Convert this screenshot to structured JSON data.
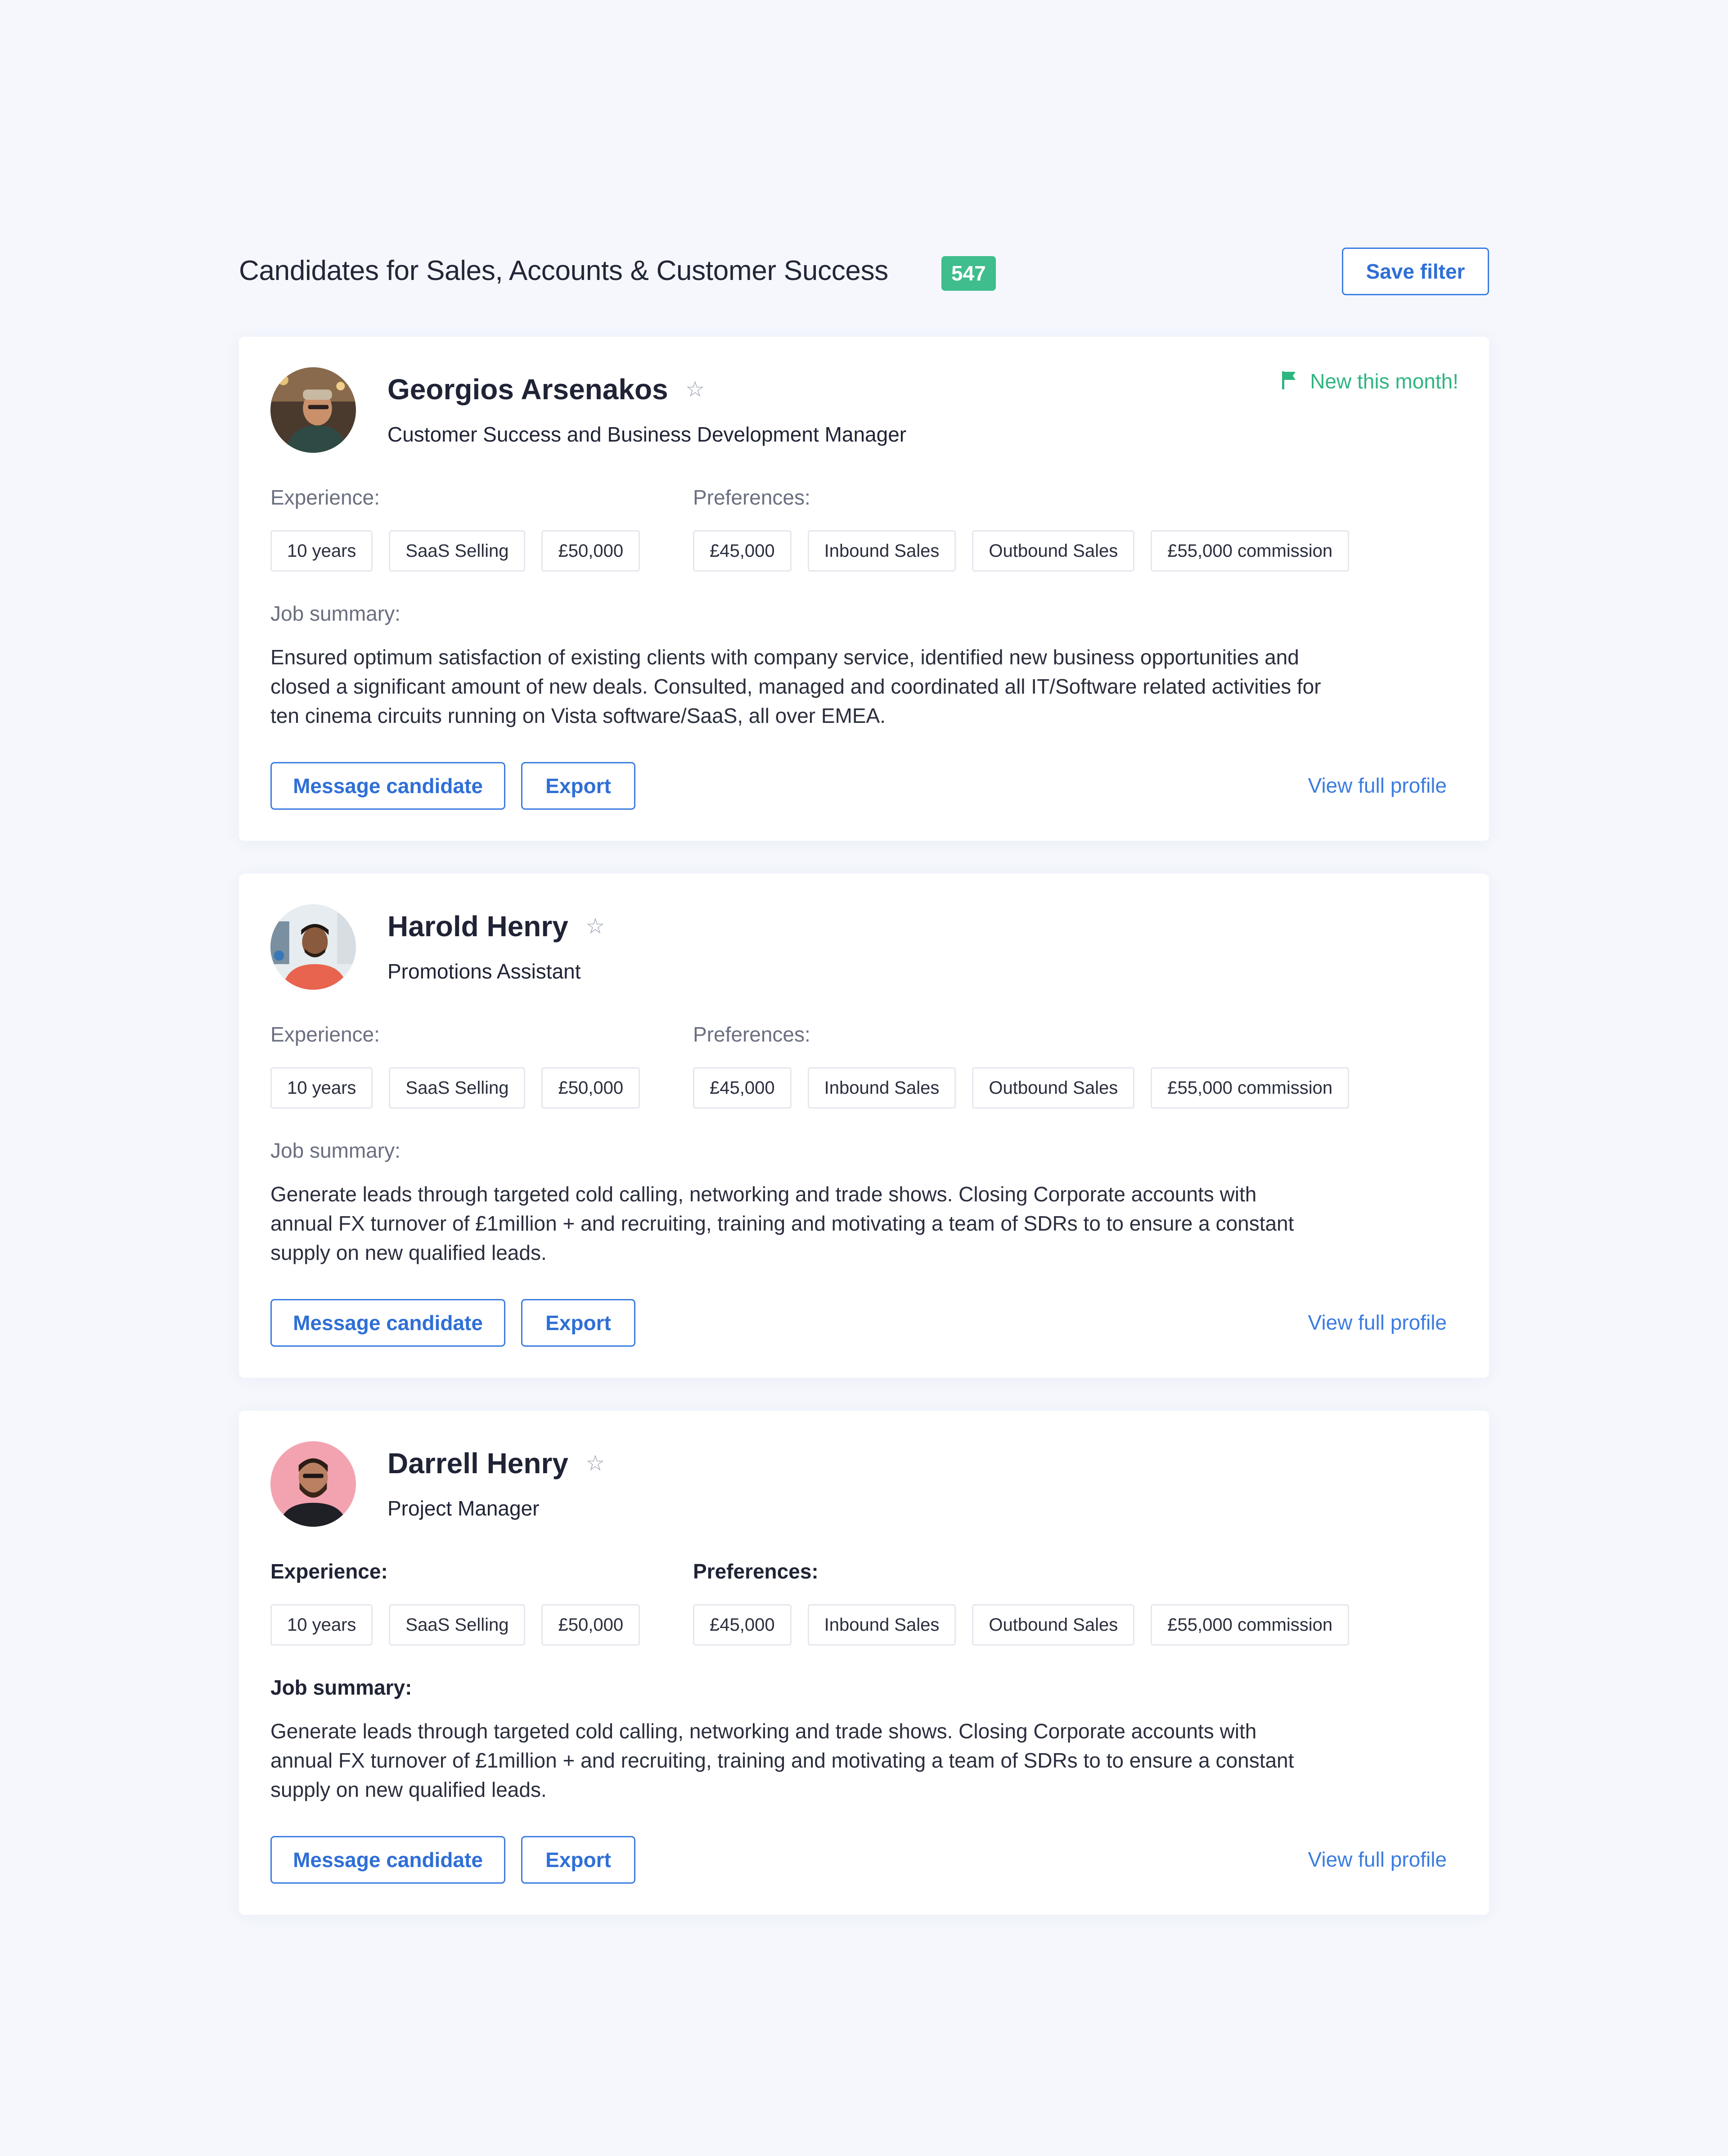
{
  "header": {
    "title": "Candidates for Sales, Accounts & Customer Success",
    "count": "547",
    "save_filter_label": "Save filter"
  },
  "colors": {
    "accent_blue": "#3b7ce0",
    "badge_green": "#3fbd8c",
    "new_green": "#2fb580",
    "background": "#f5f7fd"
  },
  "candidates": [
    {
      "name": "Georgios Arsenakos",
      "role": "Customer Success and Business Development Manager",
      "new_label": "New this month!",
      "experience_label": "Experience:",
      "preferences_label": "Preferences:",
      "summary_label": "Job summary:",
      "experience_tags": [
        "10 years",
        "SaaS Selling",
        "£50,000"
      ],
      "preference_tags": [
        "£45,000",
        "Inbound Sales",
        "Outbound Sales",
        "£55,000 commission"
      ],
      "summary": "Ensured optimum satisfaction of existing clients with company service, identified new business opportunities and closed a significant amount of new deals. Consulted, managed and coordinated all IT/Software related activities for ten cinema circuits running on Vista software/SaaS, all over EMEA.",
      "message_label": "Message candidate",
      "export_label": "Export",
      "view_profile_label": "View full profile"
    },
    {
      "name": "Harold Henry",
      "role": "Promotions Assistant",
      "experience_label": "Experience:",
      "preferences_label": "Preferences:",
      "summary_label": "Job summary:",
      "experience_tags": [
        "10 years",
        "SaaS Selling",
        "£50,000"
      ],
      "preference_tags": [
        "£45,000",
        "Inbound Sales",
        "Outbound Sales",
        "£55,000 commission"
      ],
      "summary": "Generate leads through targeted cold calling, networking and trade shows. Closing Corporate accounts with annual FX turnover of £1million + and recruiting, training and motivating a team of SDRs to to ensure a constant supply on new qualified leads.",
      "message_label": "Message candidate",
      "export_label": "Export",
      "view_profile_label": "View full profile"
    },
    {
      "name": "Darrell Henry",
      "role": "Project Manager",
      "experience_label": "Experience:",
      "preferences_label": "Preferences:",
      "summary_label": "Job summary:",
      "experience_tags": [
        "10 years",
        "SaaS Selling",
        "£50,000"
      ],
      "preference_tags": [
        "£45,000",
        "Inbound Sales",
        "Outbound Sales",
        "£55,000 commission"
      ],
      "summary": "Generate leads through targeted cold calling, networking and trade shows. Closing Corporate accounts with annual FX turnover of £1million + and recruiting, training and motivating a team of SDRs to to ensure a constant supply on new qualified leads.",
      "message_label": "Message candidate",
      "export_label": "Export",
      "view_profile_label": "View full profile"
    }
  ]
}
